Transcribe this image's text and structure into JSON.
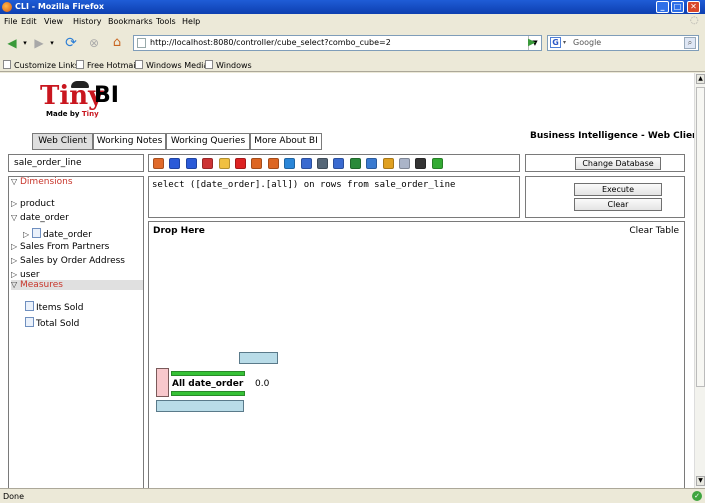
{
  "browser": {
    "title": "CLI - Mozilla Firefox",
    "menu": [
      "File",
      "Edit",
      "View",
      "History",
      "Bookmarks",
      "Tools",
      "Help"
    ],
    "url": "http://localhost:8080/controller/cube_select?combo_cube=2",
    "search_placeholder": "Google",
    "bookmarks": [
      "Customize Links",
      "Free Hotmail",
      "Windows Media",
      "Windows"
    ],
    "status": "Done"
  },
  "app": {
    "logo_text": "Tiny",
    "logo_bi": "BI",
    "made_by": "Made by",
    "made_by_brand": "Tiny",
    "tabs": [
      "Web Client",
      "Working Notes",
      "Working Queries",
      "More About BI"
    ],
    "active_tab": "Web Client",
    "header_title": "Business Intelligence - Web Client",
    "cube_name": "sale_order_line",
    "dimensions_label": "Dimensions",
    "measures_label": "Measures",
    "dimensions": [
      {
        "label": "product"
      },
      {
        "label": "date_order"
      },
      {
        "label": "date_order"
      },
      {
        "label": "Sales From Partners"
      },
      {
        "label": "Sales by Order Address"
      },
      {
        "label": "user"
      }
    ],
    "measures": [
      {
        "label": "Items Sold"
      },
      {
        "label": "Total Sold"
      }
    ],
    "query_text": "select ([date_order].[all]) on rows from sale_order_line",
    "change_database_label": "Change Database",
    "execute_label": "Execute",
    "clear_label": "Clear",
    "drop_here_label": "Drop Here",
    "clear_table_label": "Clear Table",
    "row_label": "All date_order",
    "cell_value": "0.0"
  },
  "toolbar_icons": [
    {
      "name": "new-query-icon",
      "color": "#e06a2a"
    },
    {
      "name": "save-icon",
      "color": "#2a5ad8"
    },
    {
      "name": "save-as-icon",
      "color": "#2a5ad8"
    },
    {
      "name": "cut-icon",
      "color": "#cc3333"
    },
    {
      "name": "page-icon",
      "color": "#f0c040"
    },
    {
      "name": "delete-icon",
      "color": "#dd2222"
    },
    {
      "name": "undo-icon",
      "color": "#dd6622"
    },
    {
      "name": "redo-icon",
      "color": "#dd6622"
    },
    {
      "name": "play-icon",
      "color": "#2a86d8"
    },
    {
      "name": "filter-icon",
      "color": "#3a6ad0"
    },
    {
      "name": "print-icon",
      "color": "#556677"
    },
    {
      "name": "funnel-icon",
      "color": "#3a6ad0"
    },
    {
      "name": "sum-icon",
      "color": "#2a8a3a"
    },
    {
      "name": "table-icon",
      "color": "#3a7ad0"
    },
    {
      "name": "bar-chart-icon",
      "color": "#e0a020"
    },
    {
      "name": "document-icon",
      "color": "#aab4c8"
    },
    {
      "name": "pen-icon",
      "color": "#333333"
    },
    {
      "name": "check-icon",
      "color": "#33aa33"
    }
  ]
}
